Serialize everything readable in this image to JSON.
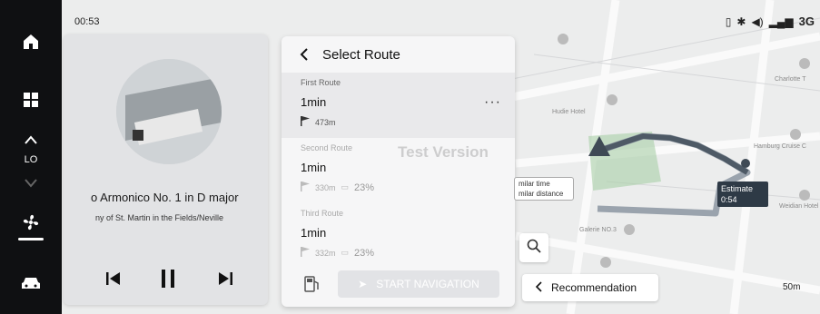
{
  "status": {
    "time": "00:53",
    "signal": "3G"
  },
  "dock": {
    "lo_label": "LO"
  },
  "media": {
    "title": "o Armonico No. 1 in D major",
    "artist": "ny of St. Martin in the Fields/Neville"
  },
  "route_panel": {
    "title": "Select Route",
    "routes": [
      {
        "label": "First Route",
        "time": "1min",
        "distance": "473m",
        "percent": ""
      },
      {
        "label": "Second Route",
        "time": "1min",
        "distance": "330m",
        "percent": "23%"
      },
      {
        "label": "Third Route",
        "time": "1min",
        "distance": "332m",
        "percent": "23%"
      }
    ],
    "more": "···",
    "start_button": "START NAVIGATION",
    "watermark": "Test Version"
  },
  "map": {
    "similar_tooltip": {
      "line1": "milar time",
      "line2": "milar distance"
    },
    "estimate": {
      "label": "Estimate",
      "value": "0:54"
    },
    "recommendation": "Recommendation",
    "scale": "50m",
    "pois": [
      "Hudie Hotel",
      "Hamburg Cruise C",
      "Galerie NO.3",
      "Charlotte T",
      "Weidian Hotel"
    ]
  },
  "colors": {
    "route_active": "#6b7a8a",
    "panel": "#f6f6f7",
    "dock": "#0f1012"
  }
}
